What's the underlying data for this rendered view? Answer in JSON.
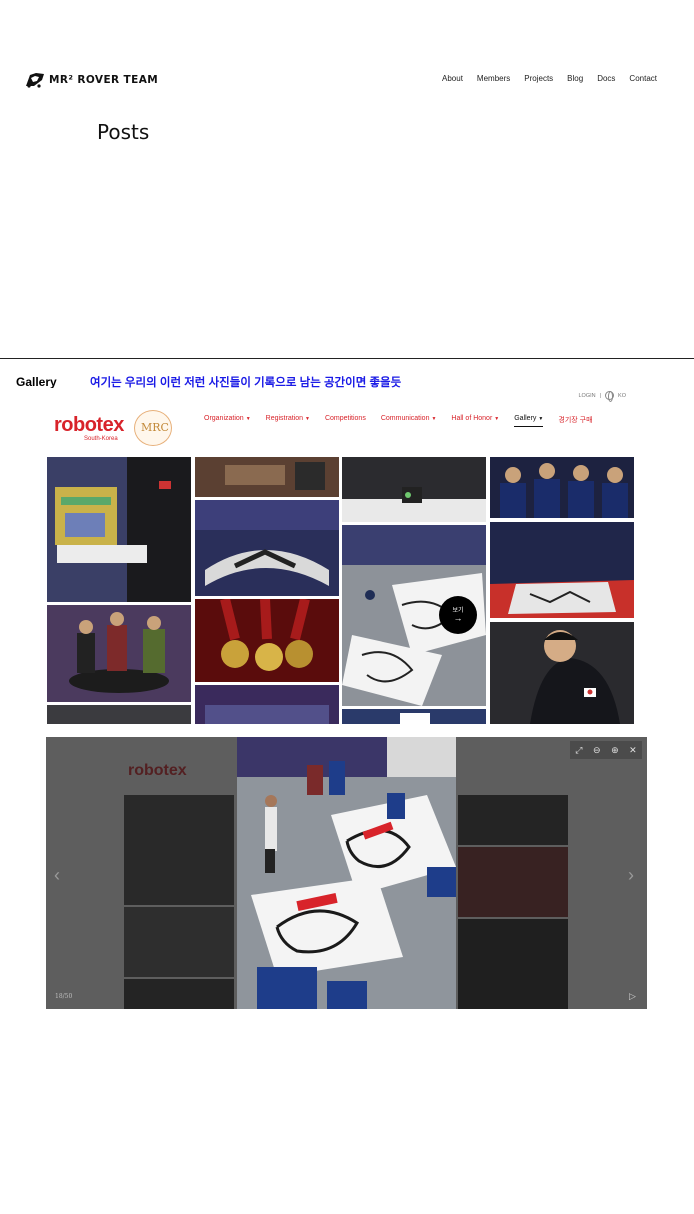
{
  "header": {
    "logo_text": "MR² ROVER TEAM",
    "nav": [
      "About",
      "Members",
      "Projects",
      "Blog",
      "Docs",
      "Contact"
    ]
  },
  "page_title": "Posts",
  "post": {
    "title": "Gallery",
    "note": "여기는 우리의 이런 저런 사진들이 기록으로 남는 공간이면 좋을듯"
  },
  "robotex": {
    "util_login": "LOGIN",
    "util_sep": "|",
    "util_lang": "KO",
    "logo_word": "robotex",
    "logo_sub": "South-Korea",
    "badge": "MRC",
    "nav": [
      {
        "label": "Organization",
        "caret": true
      },
      {
        "label": "Registration",
        "caret": true
      },
      {
        "label": "Competitions",
        "caret": false
      },
      {
        "label": "Communication",
        "caret": true
      },
      {
        "label": "Hall of Honor",
        "caret": true
      },
      {
        "label": "Gallery",
        "caret": true
      },
      {
        "label": "경기장 구매",
        "caret": false
      }
    ],
    "hover_label": "보기",
    "hover_arrow": "→"
  },
  "lightbox": {
    "counter": "18/50",
    "prev_icon": "‹",
    "next_icon": "›",
    "tools": [
      "⤢",
      "⊖",
      "⊕",
      "✕"
    ],
    "play_icon": "▷"
  },
  "colors": {
    "brand_red": "#d8232a",
    "note_blue": "#1a1ae6"
  }
}
